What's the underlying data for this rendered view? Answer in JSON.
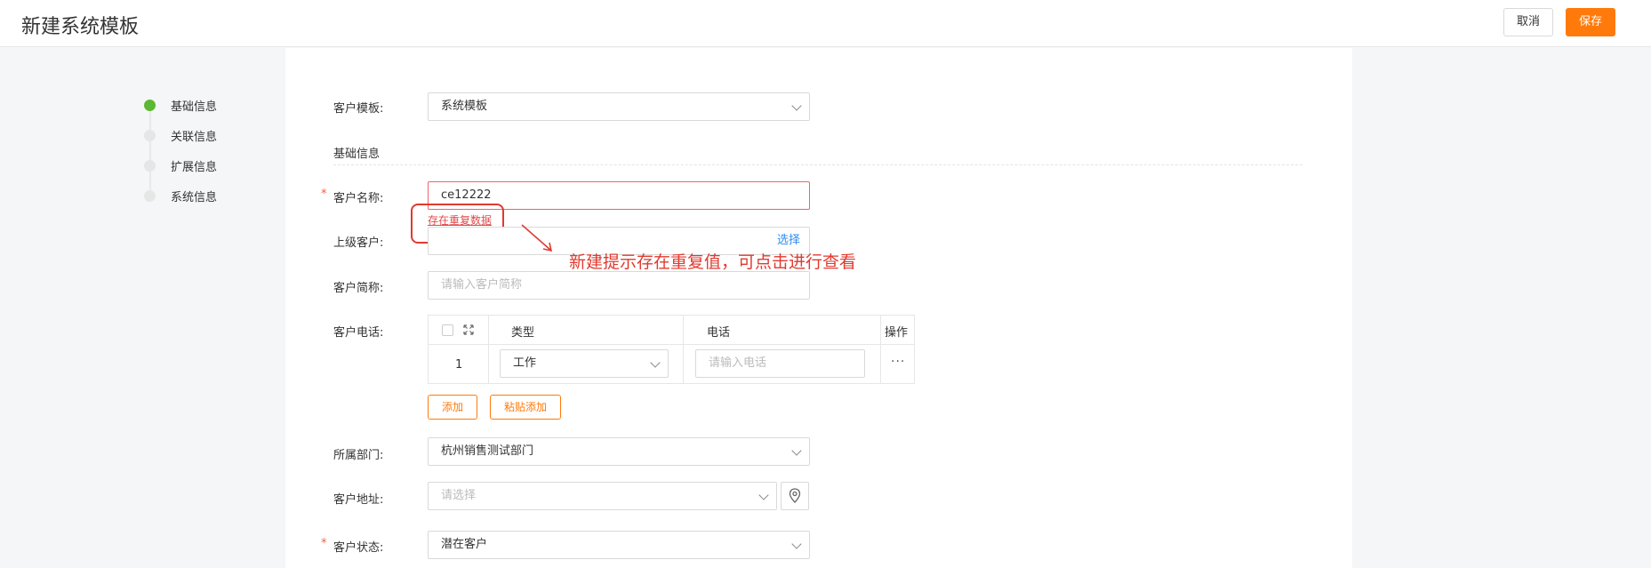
{
  "header": {
    "title": "新建系统模板",
    "cancel_label": "取消",
    "save_label": "保存"
  },
  "steps": [
    {
      "label": "基础信息",
      "active": true
    },
    {
      "label": "关联信息",
      "active": false
    },
    {
      "label": "扩展信息",
      "active": false
    },
    {
      "label": "系统信息",
      "active": false
    }
  ],
  "form": {
    "template_label": "客户模板:",
    "template_value": "系统模板",
    "section_title": "基础信息",
    "name_label": "客户名称:",
    "name_value": "ce12222",
    "duplicate_link": "存在重复数据",
    "parent_label": "上级客户:",
    "parent_choose": "选择",
    "short_label": "客户简称:",
    "short_placeholder": "请输入客户简称",
    "phone_label": "客户电话:",
    "phone_table": {
      "col_type": "类型",
      "col_phone": "电话",
      "col_action": "操作",
      "row_index": "1",
      "row_type": "工作",
      "row_phone_placeholder": "请输入电话",
      "row_more": "···"
    },
    "add_label": "添加",
    "paste_add_label": "粘贴添加",
    "dept_label": "所属部门:",
    "dept_value": "杭州销售测试部门",
    "address_label": "客户地址:",
    "address_placeholder": "请选择",
    "status_label": "客户状态:",
    "status_value": "潜在客户",
    "required_mark": "*"
  },
  "annotation": {
    "text": "新建提示存在重复值，可点击进行查看"
  },
  "colors": {
    "accent": "#ff7a0a",
    "active_step": "#5cb832",
    "error": "#f0626a",
    "annotation": "#e03a2f",
    "link": "#2b8cf0"
  }
}
